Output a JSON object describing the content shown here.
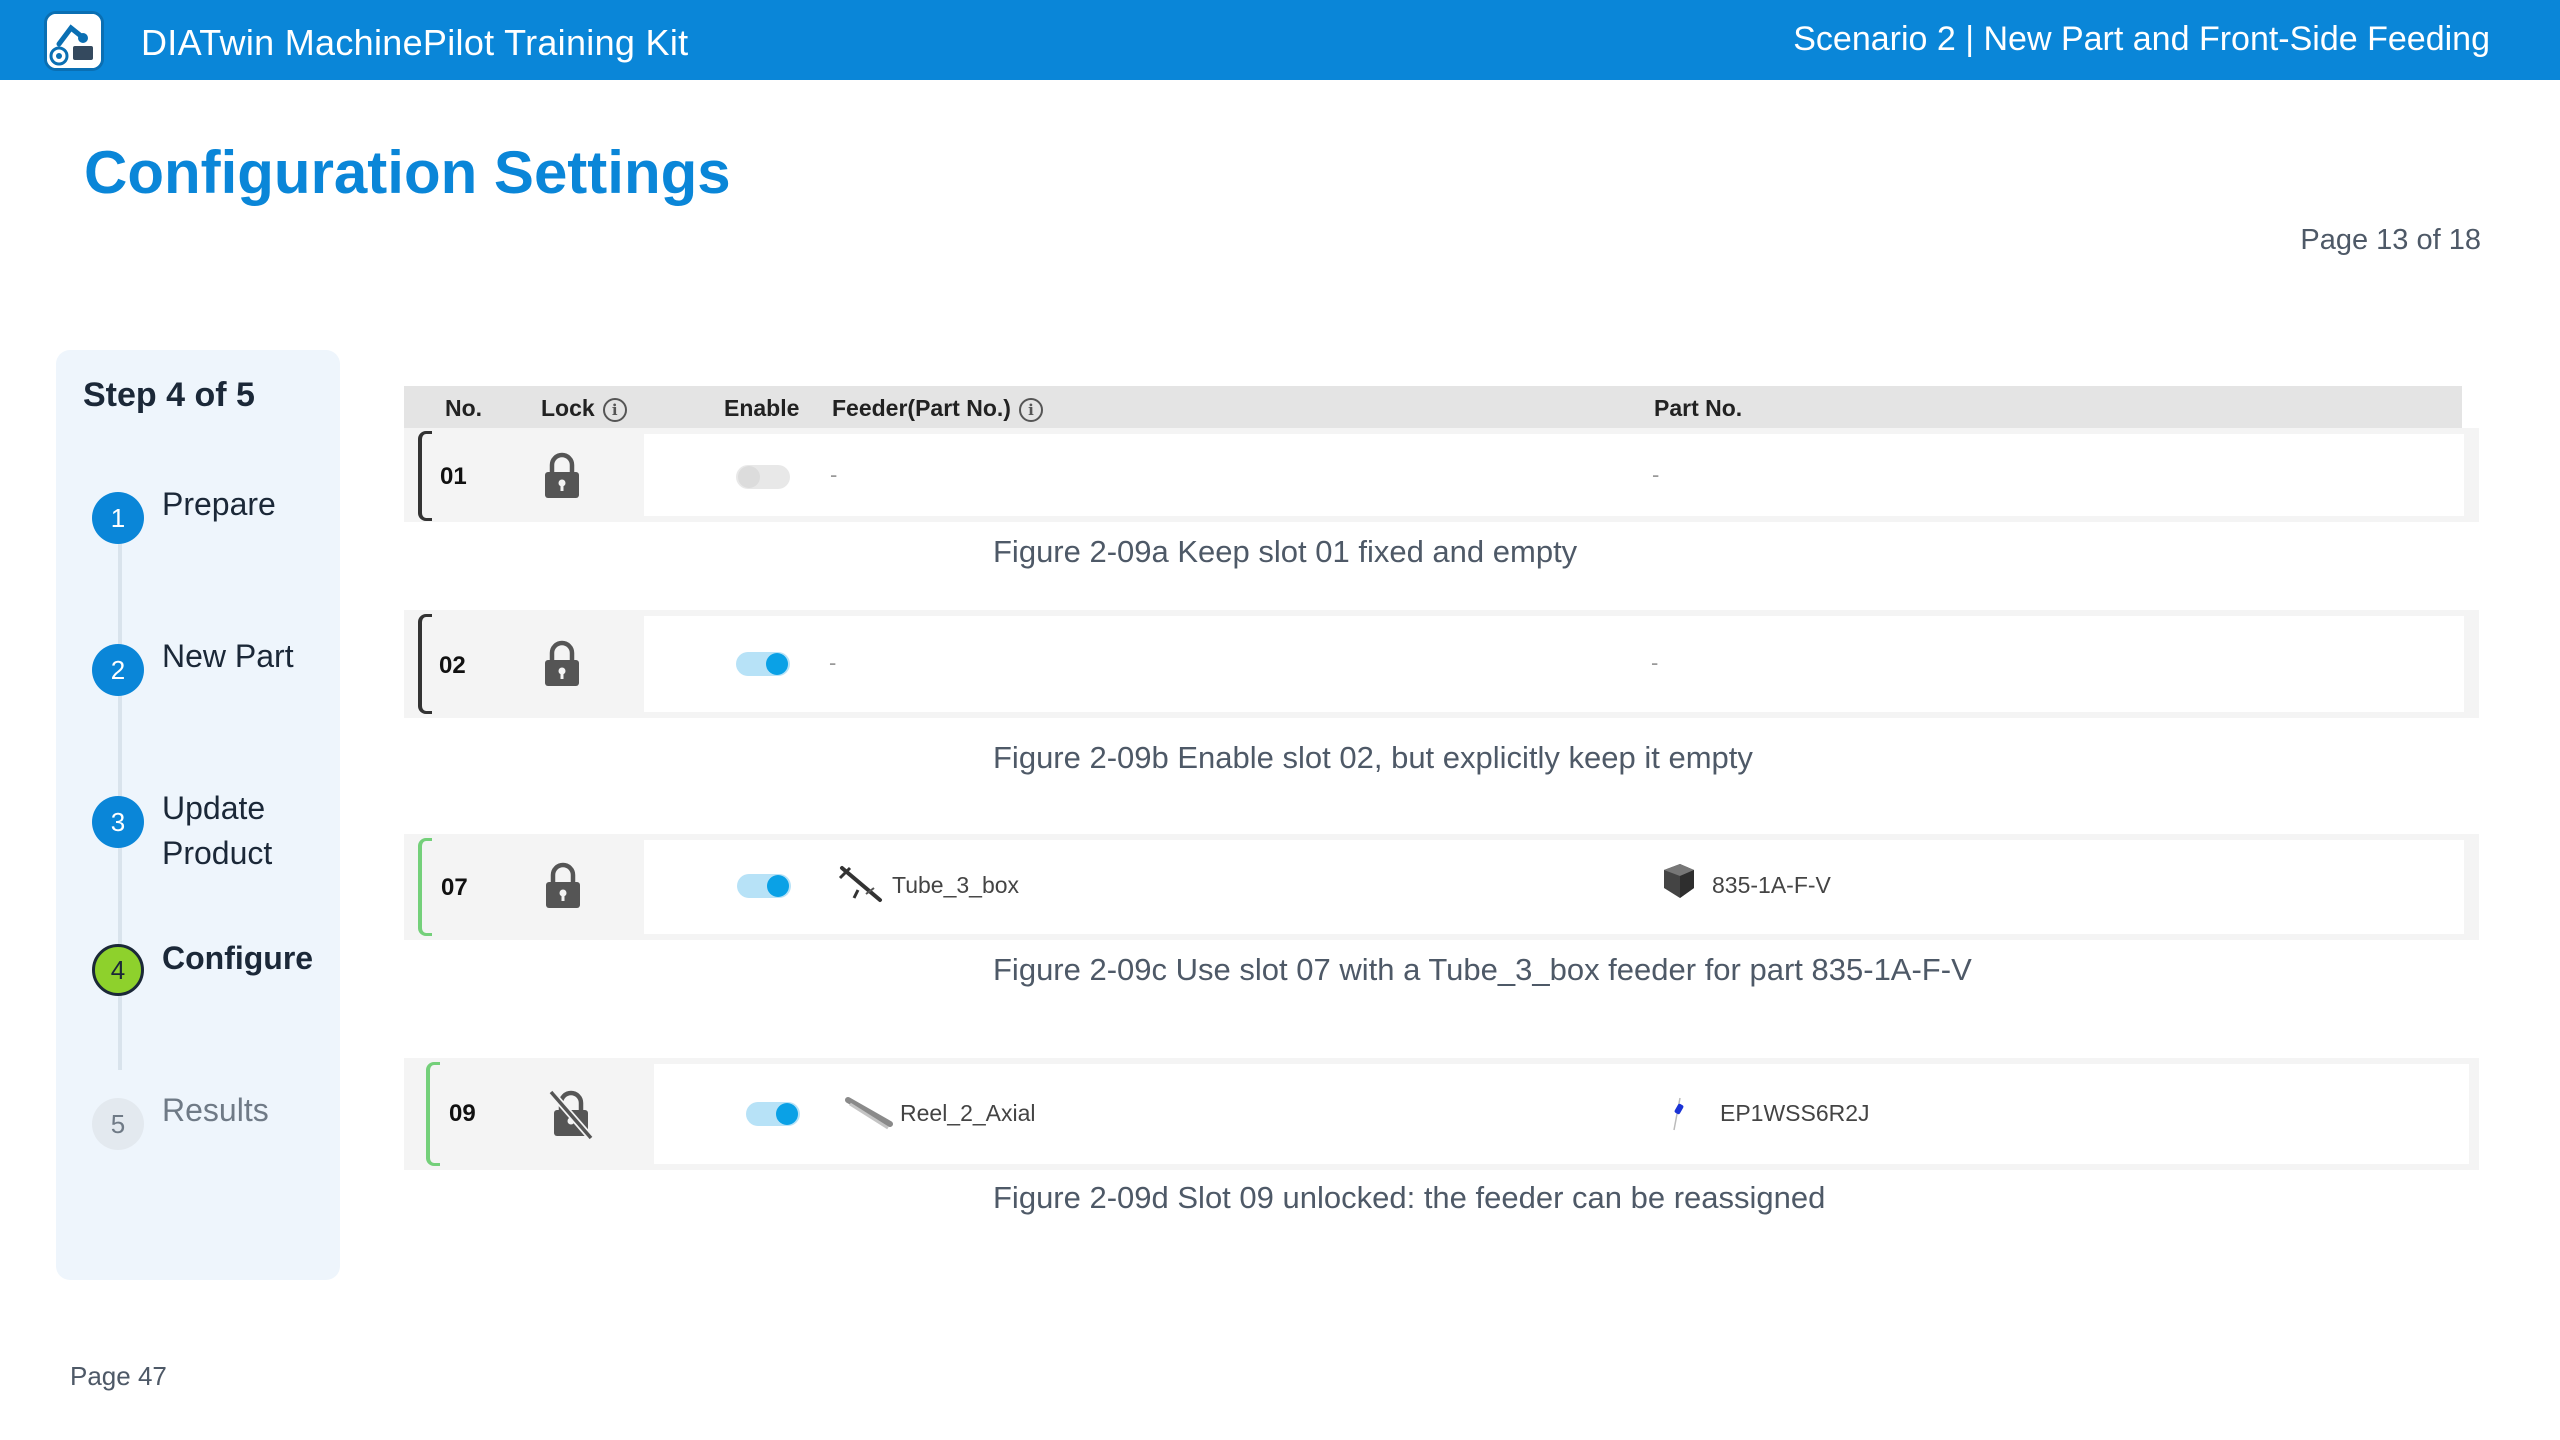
{
  "header": {
    "app_title": "DIATwin MachinePilot Training Kit",
    "scenario_title": "Scenario 2 | New Part and Front-Side Feeding",
    "logo_icon": "diatwin-logo-icon"
  },
  "page": {
    "heading": "Configuration Settings",
    "counter": "Page 13 of 18",
    "footer": "Page 47"
  },
  "sidebar": {
    "step_count": "Step 4 of 5",
    "steps": [
      {
        "number": "1",
        "label": "Prepare",
        "state": "done"
      },
      {
        "number": "2",
        "label": "New Part",
        "state": "done"
      },
      {
        "number": "3",
        "label": "Update Product",
        "state": "done"
      },
      {
        "number": "4",
        "label": "Configure",
        "state": "active"
      },
      {
        "number": "5",
        "label": "Results",
        "state": "pending"
      }
    ]
  },
  "table": {
    "columns": {
      "no": "No.",
      "lock": "Lock",
      "enable": "Enable",
      "feeder": "Feeder(Part No.)",
      "part_no": "Part No."
    },
    "info_icon": "info-icon",
    "rows": [
      {
        "no": "01",
        "locked": true,
        "enabled": false,
        "feeder": "-",
        "part_no": "-",
        "caption": "Figure 2-09a  Keep slot 01 fixed and empty"
      },
      {
        "no": "02",
        "locked": true,
        "enabled": true,
        "feeder": "-",
        "part_no": "-",
        "caption": "Figure 2-09b  Enable slot 02, but explicitly keep it empty"
      },
      {
        "no": "07",
        "locked": true,
        "enabled": true,
        "feeder": "Tube_3_box",
        "part_no": "835-1A-F-V",
        "feeder_icon": "tube-feeder-icon",
        "part_icon": "part-box-icon",
        "caption": "Figure 2-09c  Use slot 07 with a Tube_3_box feeder for part 835-1A-F-V"
      },
      {
        "no": "09",
        "locked": false,
        "enabled": true,
        "feeder": "Reel_2_Axial",
        "part_no": "EP1WSS6R2J",
        "feeder_icon": "reel-feeder-icon",
        "part_icon": "axial-part-icon",
        "caption": "Figure 2-09d Slot 09 unlocked: the feeder can be reassigned"
      }
    ]
  },
  "colors": {
    "brand_blue": "#0a86d8",
    "active_step": "#8ed12c",
    "toggle_on": "#0aa1e6"
  }
}
